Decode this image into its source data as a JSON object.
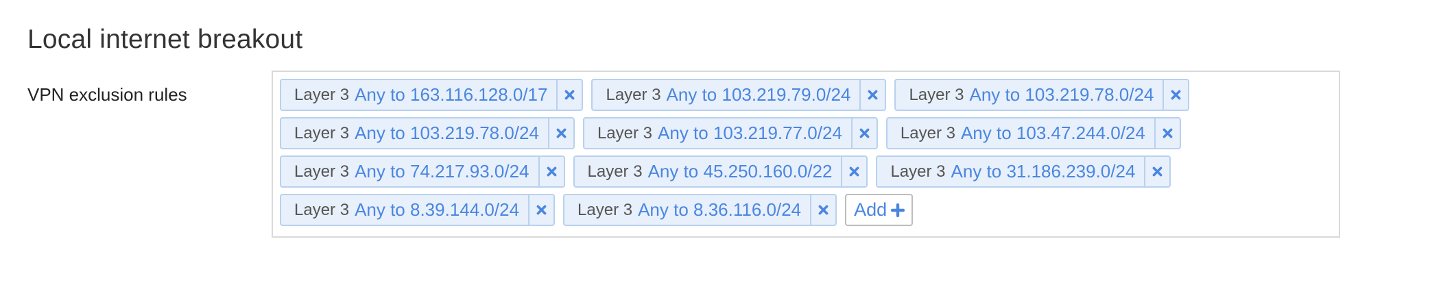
{
  "section": {
    "title": "Local internet breakout"
  },
  "vpn_exclusion": {
    "label": "VPN exclusion rules",
    "rules": [
      {
        "type": "Layer 3",
        "value": "Any to 163.116.128.0/17"
      },
      {
        "type": "Layer 3",
        "value": "Any to 103.219.79.0/24"
      },
      {
        "type": "Layer 3",
        "value": "Any to 103.219.78.0/24"
      },
      {
        "type": "Layer 3",
        "value": "Any to 103.219.78.0/24"
      },
      {
        "type": "Layer 3",
        "value": "Any to 103.219.77.0/24"
      },
      {
        "type": "Layer 3",
        "value": "Any to 103.47.244.0/24"
      },
      {
        "type": "Layer 3",
        "value": "Any to 74.217.93.0/24"
      },
      {
        "type": "Layer 3",
        "value": "Any to 45.250.160.0/22"
      },
      {
        "type": "Layer 3",
        "value": "Any to 31.186.239.0/24"
      },
      {
        "type": "Layer 3",
        "value": "Any to 8.39.144.0/24"
      },
      {
        "type": "Layer 3",
        "value": "Any to 8.36.116.0/24"
      }
    ],
    "add_label": "Add",
    "remove_icon": "close-icon",
    "add_icon": "plus-icon"
  },
  "colors": {
    "accent": "#4a86e0",
    "tag_background": "#e8f0fb",
    "tag_border": "#b8d1ef"
  }
}
